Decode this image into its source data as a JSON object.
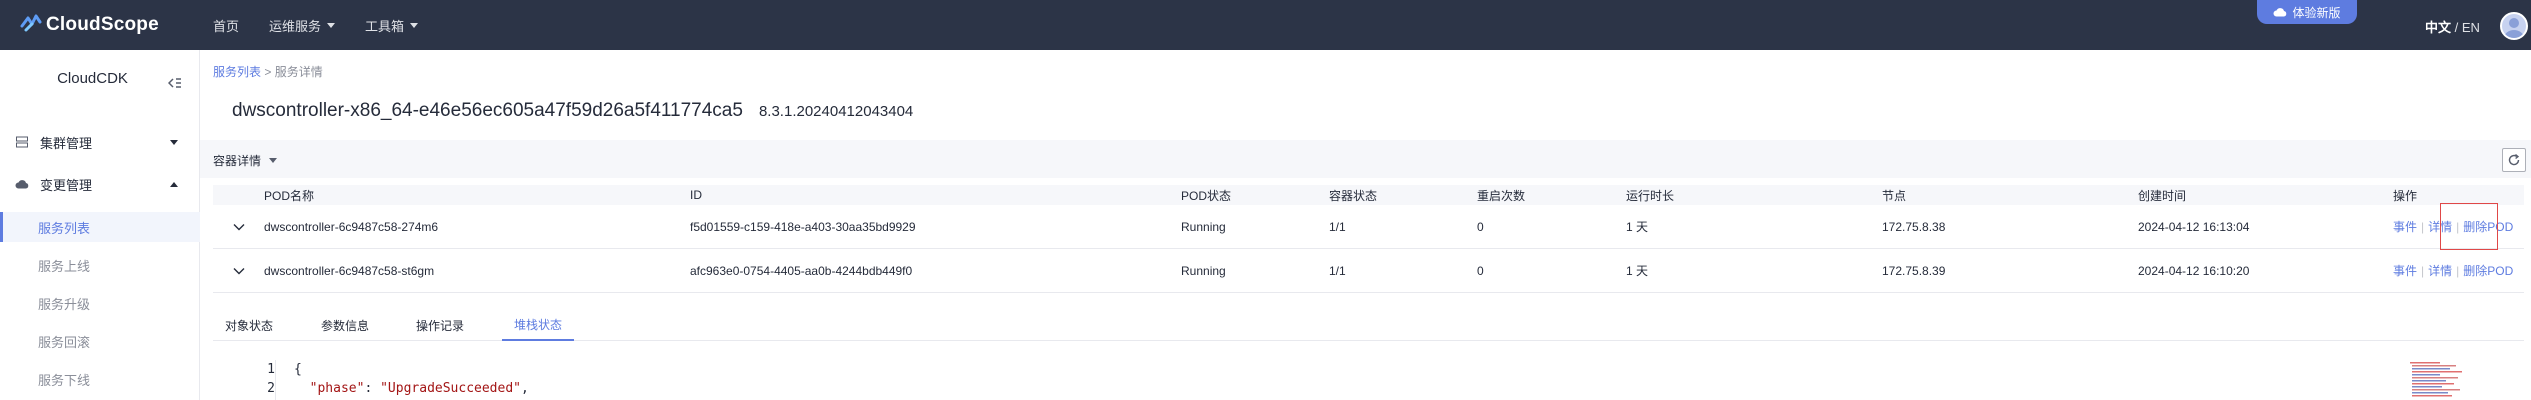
{
  "header": {
    "brand": "CloudScope",
    "nav": [
      {
        "label": "首页",
        "has_caret": false
      },
      {
        "label": "运维服务",
        "has_caret": true
      },
      {
        "label": "工具箱",
        "has_caret": true
      }
    ],
    "try_new": "体验新版",
    "lang_zh": "中文",
    "lang_sep": " / ",
    "lang_en": "EN"
  },
  "sidebar": {
    "title": "CloudCDK",
    "groups": [
      {
        "label": "集群管理",
        "icon": "server-icon",
        "expanded": false
      },
      {
        "label": "变更管理",
        "icon": "cloud-icon",
        "expanded": true
      }
    ],
    "items": [
      {
        "label": "服务列表",
        "active": true
      },
      {
        "label": "服务上线",
        "active": false
      },
      {
        "label": "服务升级",
        "active": false
      },
      {
        "label": "服务回滚",
        "active": false
      },
      {
        "label": "服务下线",
        "active": false
      }
    ]
  },
  "breadcrumb": {
    "parent": "服务列表",
    "separator": " > ",
    "current": "服务详情"
  },
  "page": {
    "title": "dwscontroller-x86_64-e46e56ec605a47f59d26a5f411774ca5",
    "version": "8.3.1.20240412043404"
  },
  "section": {
    "label": "容器详情"
  },
  "table": {
    "columns": [
      "POD名称",
      "ID",
      "POD状态",
      "容器状态",
      "重启次数",
      "运行时长",
      "节点",
      "创建时间",
      "操作"
    ],
    "rows": [
      {
        "pod_name": "dwscontroller-6c9487c58-274m6",
        "id": "f5d01559-c159-418e-a403-30aa35bd9929",
        "pod_status": "Running",
        "container_status": "1/1",
        "restarts": "0",
        "uptime": "1 天",
        "node": "172.75.8.38",
        "created": "2024-04-12 16:13:04"
      },
      {
        "pod_name": "dwscontroller-6c9487c58-st6gm",
        "id": "afc963e0-0754-4405-aa0b-4244bdb449f0",
        "pod_status": "Running",
        "container_status": "1/1",
        "restarts": "0",
        "uptime": "1 天",
        "node": "172.75.8.39",
        "created": "2024-04-12 16:10:20"
      }
    ],
    "actions": {
      "events": "事件",
      "details": "详情",
      "delete": "删除POD"
    }
  },
  "tabs": [
    {
      "label": "对象状态",
      "active": false
    },
    {
      "label": "参数信息",
      "active": false
    },
    {
      "label": "操作记录",
      "active": false
    },
    {
      "label": "堆栈状态",
      "active": true
    }
  ],
  "code": {
    "line_numbers": [
      "1",
      "2"
    ],
    "line1": "{",
    "line2_key": "\"phase\"",
    "line2_colon": ": ",
    "line2_value": "\"UpgradeSucceeded\"",
    "line2_comma": ","
  },
  "colors": {
    "topbar": "#2c3447",
    "accent": "#5e7ce0",
    "highlight": "#e04848"
  }
}
